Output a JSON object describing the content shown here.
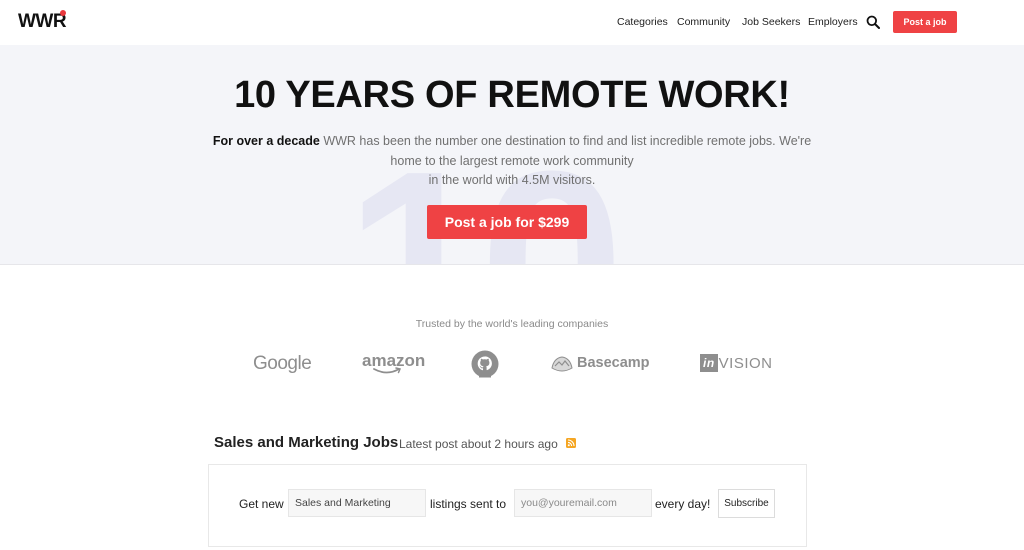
{
  "header": {
    "logo": "WWR",
    "nav": [
      "Categories",
      "Community",
      "Job Seekers",
      "Employers"
    ],
    "post_job_label": "Post a job"
  },
  "hero": {
    "bg_number": "10",
    "title": "10 YEARS OF REMOTE WORK!",
    "desc_bold": "For over a decade",
    "desc_line1": " WWR has been the number one destination to find and list incredible remote jobs. We're",
    "desc_line2": "home to the largest remote work community",
    "desc_line3": "in the world with 4.5M visitors.",
    "cta_label": "Post a job for $299"
  },
  "trusted": {
    "caption": "Trusted by the world's leading companies",
    "logos": [
      "Google",
      "amazon",
      "github",
      "Basecamp",
      "invision"
    ],
    "invision_box": "in",
    "invision_rest": "VISION"
  },
  "jobs": {
    "title": "Sales and Marketing Jobs",
    "latest": "Latest post about 2 hours ago"
  },
  "subscribe": {
    "text_get_new": "Get new",
    "category_value": "Sales and Marketing",
    "text_listings": "listings sent to",
    "email_placeholder": "you@youremail.com",
    "text_every_day": "every day!",
    "button_label": "Subscribe"
  },
  "colors": {
    "accent": "#ef4244",
    "hero_bg": "#f4f5f9",
    "logo_gray": "#8e8e8e",
    "rss": "#f5a623"
  }
}
